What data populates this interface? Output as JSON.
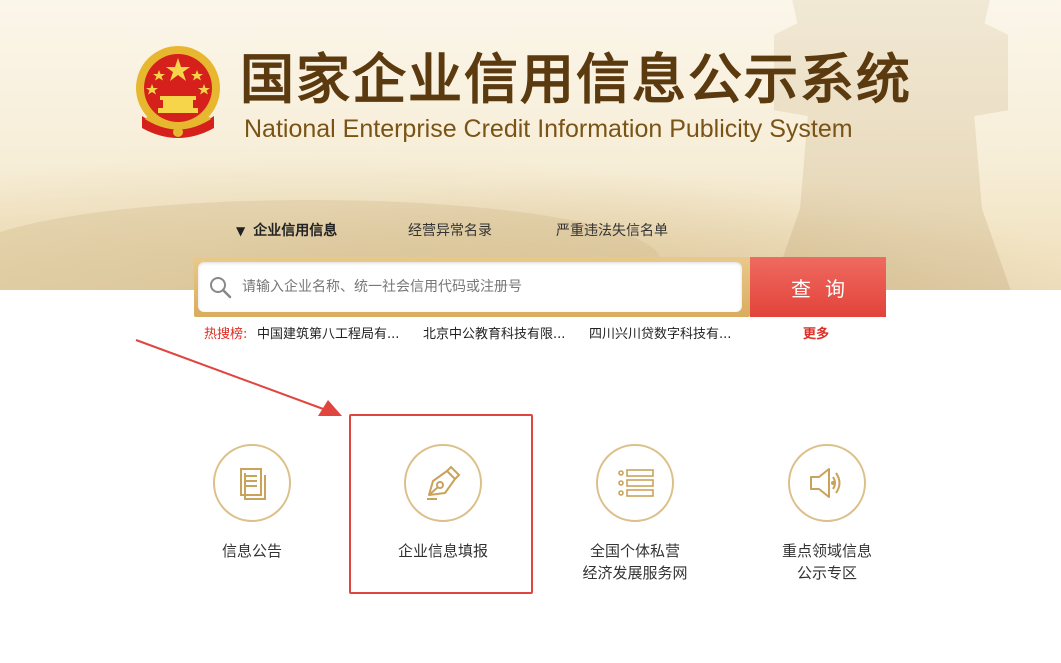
{
  "header": {
    "title_cn": "国家企业信用信息公示系统",
    "title_en": "National Enterprise Credit Information Publicity System",
    "emblem_icon": "national-emblem-icon"
  },
  "tabs": [
    {
      "label": "企业信用信息",
      "active": true,
      "marker": "▼"
    },
    {
      "label": "经营异常名录",
      "active": false
    },
    {
      "label": "严重违法失信名单",
      "active": false
    }
  ],
  "search": {
    "placeholder": "请输入企业名称、统一社会信用代码或注册号",
    "button_label": "查询"
  },
  "hot_search": {
    "label": "热搜榜:",
    "items": [
      "中国建筑第八工程局有...",
      "北京中公教育科技有限...",
      "四川兴川贷数字科技有..."
    ],
    "more_label": "更多"
  },
  "services": [
    {
      "label_line1": "信息公告",
      "label_line2": "",
      "icon": "document-icon"
    },
    {
      "label_line1": "企业信息填报",
      "label_line2": "",
      "icon": "pen-nib-icon",
      "highlighted": true
    },
    {
      "label_line1": "全国个体私营",
      "label_line2": "经济发展服务网",
      "icon": "list-icon"
    },
    {
      "label_line1": "重点领域信息",
      "label_line2": "公示专区",
      "icon": "speaker-icon"
    }
  ],
  "colors": {
    "accent_red": "#e2433a",
    "gold": "#dcc08a",
    "title_brown": "#5a3a0e"
  }
}
